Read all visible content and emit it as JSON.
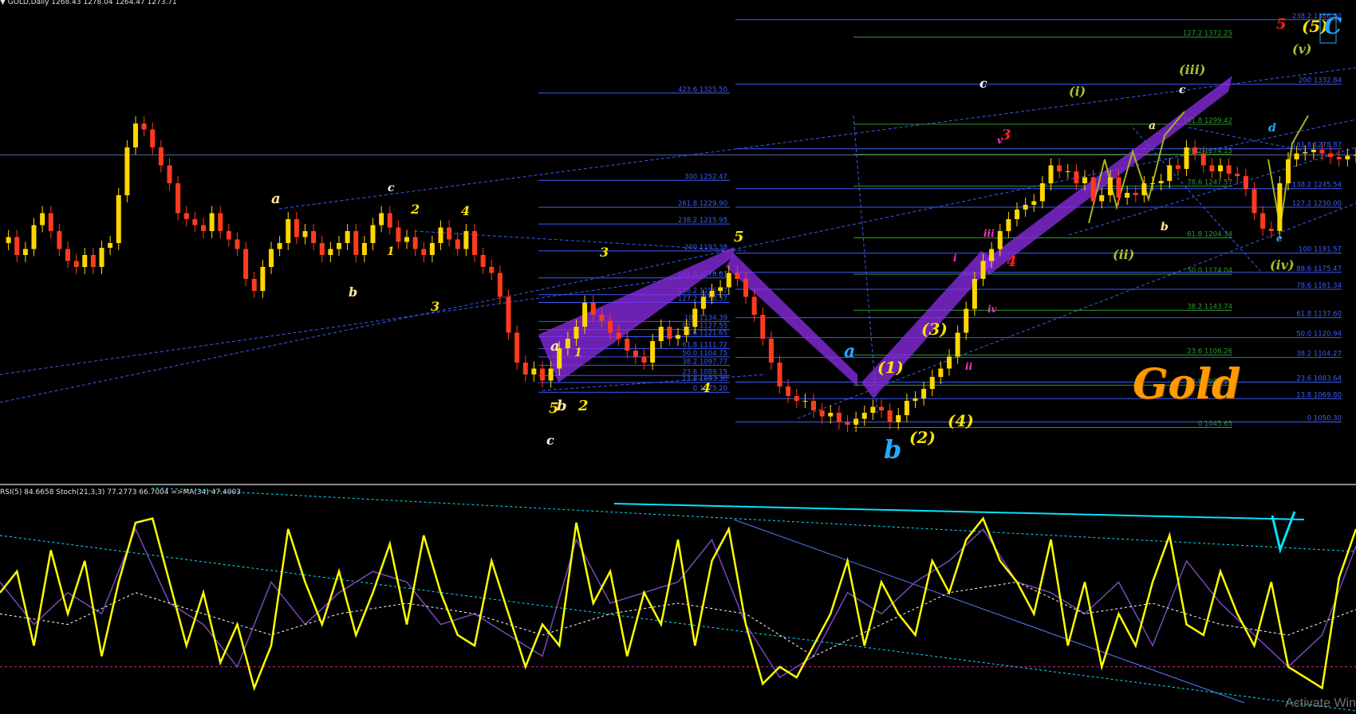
{
  "header": {
    "symbol_line": "▼ GOLD,Daily  1268.43 1278.04 1264.47 1273.71",
    "indicator_line": "RSI(5) 84.6658  Stoch(21,3,3) 77.2773 66.7004  =>MA(34) 47.4003"
  },
  "title_label": "Gold",
  "watermark": "Activate Win",
  "colors": {
    "background": "#000000",
    "candle_up": "#ffd700",
    "candle_down": "#ff3b1f",
    "fib_line": "#3a5cff",
    "fib_green": "#2e9a2e",
    "purple_pattern": "#8a2be2",
    "rsi": "#ffff00",
    "stoch_main": "#2a7a2a",
    "stoch_signal": "#9b30ff",
    "ma": "#ffffff",
    "cyan": "#00e5ff",
    "olive": "#a8b020",
    "gold_text": "#ff9a00"
  },
  "chart_data": [
    {
      "type": "line",
      "title": "GOLD,Daily",
      "ohlc": {
        "open": 1268.43,
        "high": 1278.04,
        "low": 1264.47,
        "close": 1273.71
      },
      "series": [
        {
          "name": "GOLD",
          "x": [
            0,
            10,
            20,
            30,
            40,
            50,
            60,
            70,
            80,
            90,
            100,
            110,
            120,
            130,
            140,
            150,
            160,
            170,
            180,
            190,
            200,
            210,
            220,
            230,
            240,
            250,
            260,
            270,
            280,
            290,
            300,
            310,
            320,
            330,
            340,
            350,
            360,
            370,
            380,
            390,
            400,
            410,
            420,
            430,
            440,
            450,
            460,
            470,
            480,
            490,
            500,
            510,
            520,
            530,
            540,
            550,
            560,
            570,
            580,
            590,
            600,
            610,
            620,
            630,
            640,
            650,
            660,
            670,
            680,
            690,
            700,
            710,
            720,
            730,
            740,
            750,
            760,
            770,
            780,
            790,
            800,
            810,
            820,
            830,
            840,
            850,
            860,
            870,
            880,
            890,
            900,
            910,
            920,
            930,
            940,
            950,
            960,
            970,
            980,
            990,
            1000,
            1010,
            1020,
            1030,
            1040,
            1050,
            1060,
            1070,
            1080,
            1090,
            1100,
            1110,
            1120,
            1130,
            1140,
            1150,
            1160,
            1170,
            1180,
            1190,
            1200,
            1210,
            1220,
            1230,
            1240,
            1250,
            1260,
            1270,
            1280,
            1290,
            1300,
            1310,
            1320,
            1330,
            1340,
            1350,
            1360,
            1370,
            1380,
            1390,
            1400,
            1410,
            1420,
            1430,
            1440,
            1450,
            1460,
            1470,
            1480,
            1490,
            1500,
            1510,
            1520,
            1530,
            1540,
            1550,
            1560,
            1570,
            1580,
            1590,
            1600
          ],
          "y": [
            1200,
            1205,
            1190,
            1195,
            1215,
            1225,
            1210,
            1195,
            1185,
            1180,
            1190,
            1180,
            1196,
            1200,
            1240,
            1280,
            1300,
            1295,
            1280,
            1265,
            1250,
            1225,
            1220,
            1215,
            1210,
            1225,
            1210,
            1203,
            1195,
            1170,
            1160,
            1180,
            1195,
            1200,
            1220,
            1205,
            1210,
            1200,
            1190,
            1195,
            1200,
            1210,
            1190,
            1200,
            1215,
            1225,
            1213,
            1201,
            1205,
            1195,
            1190,
            1200,
            1213,
            1203,
            1195,
            1210,
            1190,
            1180,
            1175,
            1155,
            1125,
            1100,
            1090,
            1095,
            1085,
            1095,
            1112,
            1120,
            1130,
            1150,
            1140,
            1135,
            1125,
            1120,
            1110,
            1105,
            1100,
            1118,
            1130,
            1120,
            1123,
            1130,
            1145,
            1155,
            1160,
            1163,
            1175,
            1170,
            1155,
            1140,
            1120,
            1100,
            1080,
            1072,
            1068,
            1068,
            1060,
            1055,
            1058,
            1050,
            1048,
            1053,
            1058,
            1063,
            1060,
            1050,
            1056,
            1068,
            1070,
            1078,
            1088,
            1095,
            1105,
            1125,
            1145,
            1170,
            1185,
            1195,
            1210,
            1220,
            1228,
            1232,
            1235,
            1250,
            1265,
            1260,
            1260,
            1250,
            1255,
            1235,
            1240,
            1255,
            1238,
            1242,
            1240,
            1250,
            1250,
            1252,
            1265,
            1262,
            1280,
            1275,
            1265,
            1260,
            1265,
            1258,
            1256,
            1245,
            1225,
            1212,
            1210,
            1250,
            1270,
            1275,
            1276,
            1278,
            1275,
            1272,
            1270,
            1273,
            1274
          ]
        }
      ],
      "fib_levels_left": [
        "423.6 1325.50",
        "300 1252.47",
        "261.8 1229.90",
        "238.2 1215.95",
        "200 1193.38",
        "161.8 1170.81",
        "138.2 1156.87",
        "127.2 1150.37",
        "100 1134.39",
        "88.6 1127.55",
        "78.6 1121.65",
        "61.8 1111.72",
        "50.0 1104.75",
        "38.2 1097.77",
        "23.6 1089.15",
        "13.8 1083.36",
        "0 1075.20"
      ],
      "fib_levels_mid": [
        "127.2 1372.25",
        "161.8 1299.42",
        "138.2 1274.15",
        "78.6 1247.57",
        "61.8 1204.34",
        "50.0 1174.04",
        "38.2 1143.74",
        "23.6 1106.26",
        "13.8 1081.11",
        "0 1045.65"
      ],
      "fib_levels_right": [
        "238.2 1386.80",
        "200 1332.84",
        "161.8 1278.87",
        "138.2 1245.54",
        "127.2 1230.00",
        "100 1191.57",
        "88.6 1175.47",
        "78.6 1161.34",
        "61.8 1137.60",
        "50.0 1120.94",
        "38.2 1104.27",
        "23.6 1083.64",
        "13.8 1069.80",
        "0 1050.30"
      ],
      "wave_labels": [
        "a",
        "b",
        "c",
        "1",
        "2",
        "3",
        "4",
        "5",
        "a",
        "b",
        "c",
        "1",
        "2",
        "3",
        "4",
        "5",
        "a",
        "b",
        "c",
        "(1)",
        "(2)",
        "(3)",
        "(4)",
        "(5)",
        "(i)",
        "(ii)",
        "(iii)",
        "(iv)",
        "(v)",
        "i",
        "ii",
        "iii",
        "iv",
        "v",
        "a",
        "b",
        "c",
        "d",
        "e",
        "3",
        "4",
        "5",
        "C"
      ]
    },
    {
      "type": "line",
      "title": "RSI(5) / Stoch(21,3,3) / MA(34)",
      "ylim": [
        0,
        100
      ],
      "series": [
        {
          "name": "RSI(5)",
          "x": [
            0,
            20,
            40,
            60,
            80,
            100,
            120,
            140,
            160,
            180,
            200,
            220,
            240,
            260,
            280,
            300,
            320,
            340,
            360,
            380,
            400,
            420,
            440,
            460,
            480,
            500,
            520,
            540,
            560,
            580,
            600,
            620,
            640,
            660,
            680,
            700,
            720,
            740,
            760,
            780,
            800,
            820,
            840,
            860,
            880,
            900,
            920,
            940,
            960,
            980,
            1000,
            1020,
            1040,
            1060,
            1080,
            1100,
            1120,
            1140,
            1160,
            1180,
            1200,
            1220,
            1240,
            1260,
            1280,
            1300,
            1320,
            1340,
            1360,
            1380,
            1400,
            1420,
            1440,
            1460,
            1480,
            1500,
            1520,
            1540,
            1560,
            1580,
            1600
          ],
          "values": [
            55,
            65,
            30,
            75,
            45,
            70,
            25,
            60,
            88,
            90,
            60,
            30,
            55,
            22,
            40,
            10,
            30,
            85,
            60,
            40,
            65,
            35,
            55,
            78,
            40,
            82,
            55,
            35,
            30,
            70,
            45,
            20,
            40,
            30,
            88,
            50,
            65,
            25,
            55,
            40,
            80,
            30,
            70,
            85,
            40,
            12,
            20,
            15,
            30,
            45,
            70,
            30,
            60,
            45,
            35,
            70,
            55,
            80,
            90,
            70,
            60,
            45,
            80,
            30,
            60,
            20,
            45,
            30,
            60,
            82,
            40,
            35,
            65,
            45,
            30,
            60,
            20,
            15,
            10,
            62,
            85
          ]
        },
        {
          "name": "Stoch(21,3,3)",
          "x": [
            0,
            40,
            80,
            120,
            160,
            200,
            240,
            280,
            320,
            360,
            400,
            440,
            480,
            520,
            560,
            600,
            640,
            680,
            720,
            760,
            800,
            840,
            880,
            920,
            960,
            1000,
            1040,
            1080,
            1120,
            1160,
            1200,
            1240,
            1280,
            1320,
            1360,
            1400,
            1440,
            1480,
            1520,
            1560,
            1600
          ],
          "values": [
            60,
            40,
            55,
            45,
            85,
            50,
            40,
            20,
            60,
            40,
            55,
            65,
            60,
            40,
            45,
            35,
            25,
            80,
            50,
            55,
            60,
            80,
            40,
            15,
            25,
            55,
            45,
            60,
            70,
            85,
            60,
            55,
            45,
            60,
            30,
            70,
            50,
            35,
            20,
            35,
            77
          ]
        },
        {
          "name": "MA(34)",
          "x": [
            0,
            80,
            160,
            240,
            320,
            400,
            480,
            560,
            640,
            720,
            800,
            880,
            960,
            1040,
            1120,
            1200,
            1280,
            1360,
            1440,
            1520,
            1600
          ],
          "values": [
            45,
            40,
            55,
            45,
            35,
            45,
            50,
            45,
            35,
            45,
            50,
            45,
            25,
            40,
            55,
            60,
            45,
            50,
            40,
            35,
            47
          ]
        }
      ]
    }
  ]
}
